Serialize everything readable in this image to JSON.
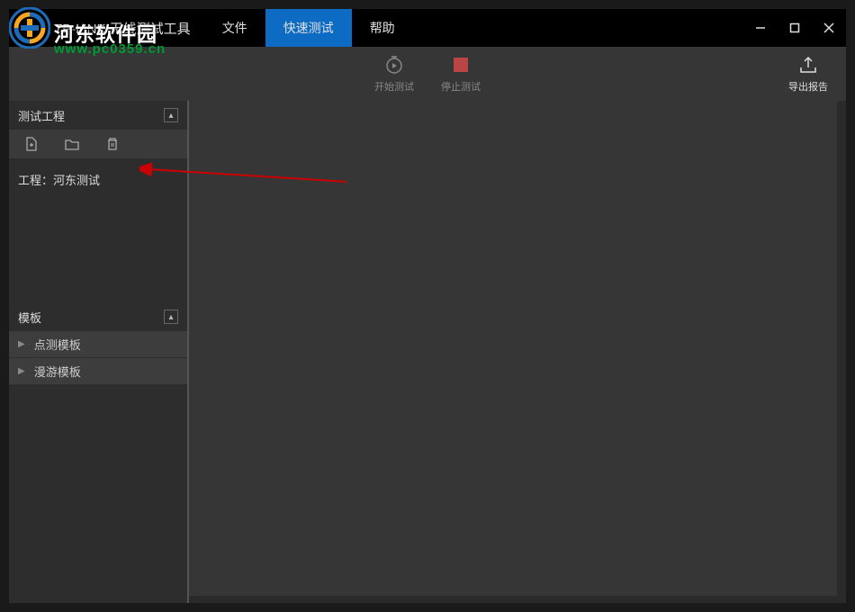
{
  "app": {
    "title": "TP-LINK 无线测试工具"
  },
  "menu": {
    "file": "文件",
    "quick_test": "快速测试",
    "help": "帮助"
  },
  "toolbar": {
    "start_test": "开始测试",
    "stop_test": "停止测试",
    "export_report": "导出报告"
  },
  "sidebar": {
    "project_section": {
      "title": "测试工程",
      "project_label": "工程：河东测试"
    },
    "template_section": {
      "title": "模板",
      "items": [
        {
          "label": "点测模板"
        },
        {
          "label": "漫游模板"
        }
      ]
    }
  },
  "watermark": {
    "text1": "河东软件园",
    "text2": "www.pc0359.cn"
  }
}
